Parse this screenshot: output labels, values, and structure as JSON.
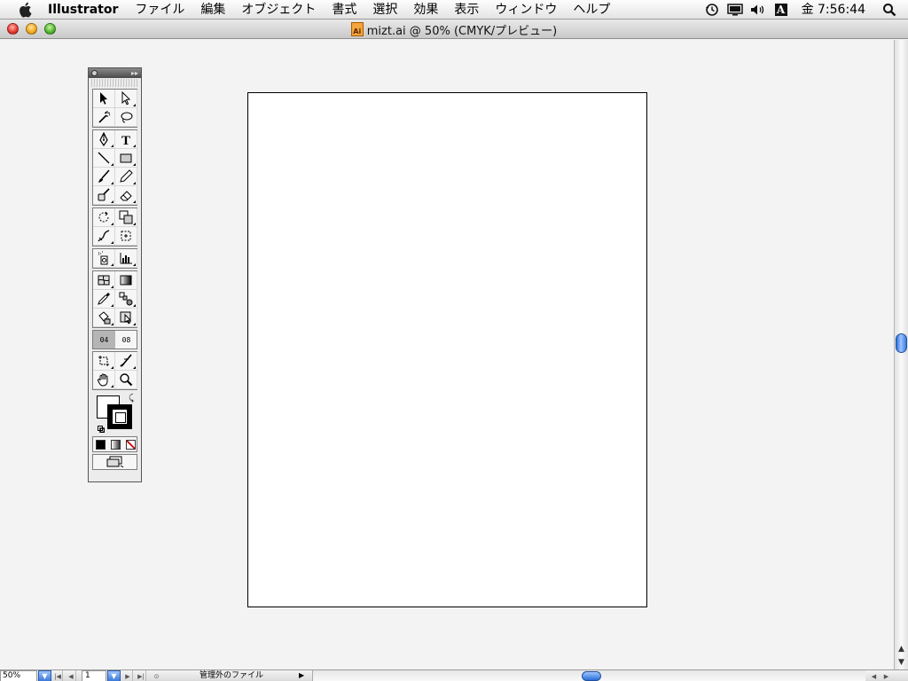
{
  "menubar": {
    "app_name": "Illustrator",
    "items": [
      "ファイル",
      "編集",
      "オブジェクト",
      "書式",
      "選択",
      "効果",
      "表示",
      "ウィンドウ",
      "ヘルプ"
    ],
    "clock": "金 7:56:44",
    "input_indicator": "A"
  },
  "window": {
    "title": "mizt.ai @ 50% (CMYK/プレビュー)",
    "badge": "Ai"
  },
  "toolbox": {
    "color_mode_left": "04",
    "color_mode_right": "08"
  },
  "statusbar": {
    "zoom": "50%",
    "page": "1",
    "status_text": "管理外のファイル"
  },
  "colors": {
    "scroll_thumb": "#3a7be0",
    "artboard": "#ffffff",
    "workspace": "#f3f3f3"
  }
}
